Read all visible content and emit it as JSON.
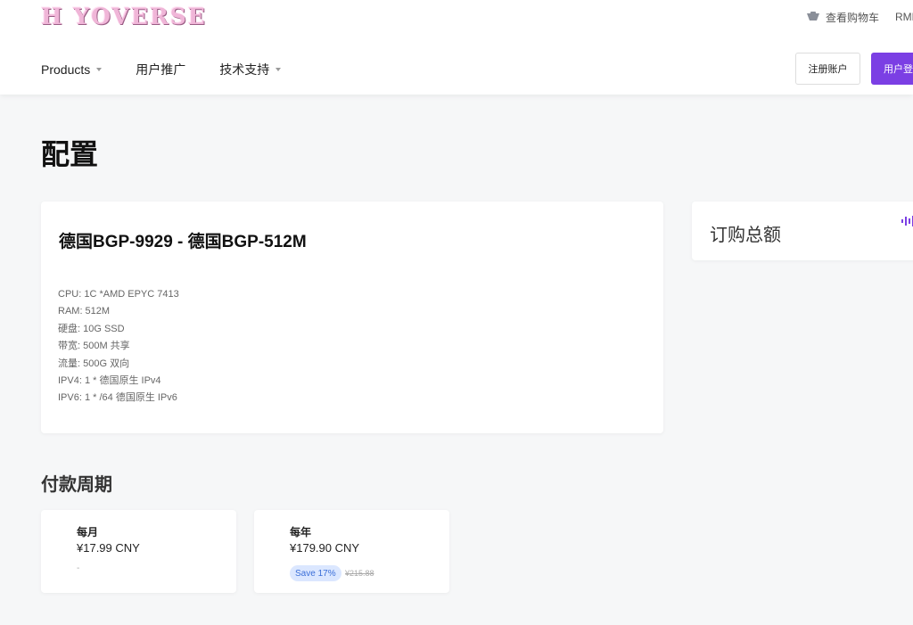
{
  "header": {
    "logo_text": "H YOVERSE",
    "cart_label": "查看购物车",
    "currency_label": "RMB",
    "nav": [
      {
        "label": "Products"
      },
      {
        "label": "用户推广"
      },
      {
        "label": "技术支持"
      }
    ],
    "register_label": "注册账户",
    "login_label": "用户登录"
  },
  "page": {
    "title": "配置"
  },
  "product": {
    "name": "德国BGP-9929 - 德国BGP-512M",
    "specs": [
      "CPU:  1C *AMD EPYC 7413",
      "RAM: 512M",
      "硬盘: 10G SSD",
      "带宽: 500M 共享",
      "流量: 500G 双向",
      "IPV4: 1 * 德国原生 IPv4",
      "IPV6: 1 * /64 德国原生 IPv6"
    ]
  },
  "summary": {
    "title": "订购总额"
  },
  "billing": {
    "title": "付款周期",
    "cycles": [
      {
        "name": "每月",
        "price": "¥17.99 CNY",
        "note": "-"
      },
      {
        "name": "每年",
        "price": "¥179.90 CNY",
        "badge": "Save 17%",
        "old_price": "¥215.88"
      }
    ]
  },
  "colors": {
    "accent": "#7b3fe4",
    "badge_bg": "#dbe7ff",
    "badge_text": "#3b6fd8"
  }
}
